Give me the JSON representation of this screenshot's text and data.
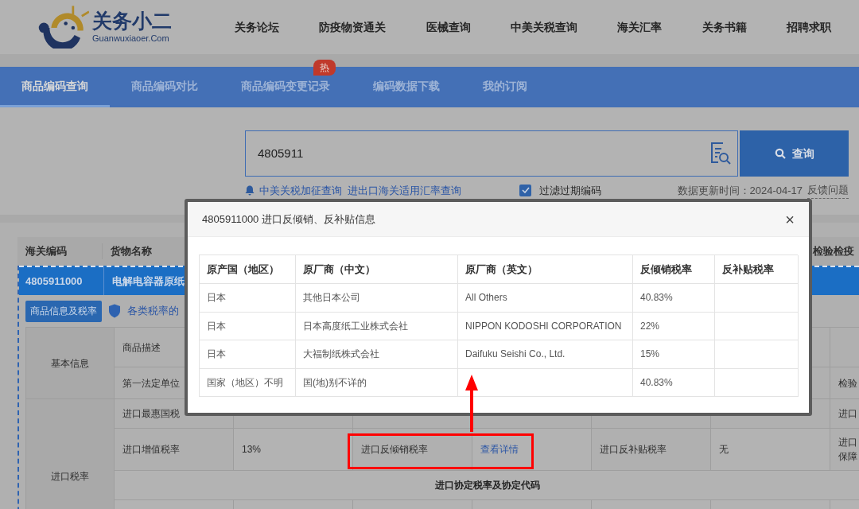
{
  "logo": {
    "name": "关务小二",
    "domain": "Guanwuxiaoer.Com"
  },
  "nav": [
    "关务论坛",
    "防疫物资通关",
    "医械查询",
    "中美关税查询",
    "海关汇率",
    "关务书籍",
    "招聘求职"
  ],
  "tabs": [
    {
      "label": "商品编码查询",
      "selected": true
    },
    {
      "label": "商品编码对比",
      "selected": false
    },
    {
      "label": "商品编码变更记录",
      "selected": false,
      "badge": "热"
    },
    {
      "label": "编码数据下载",
      "selected": false
    },
    {
      "label": "我的订阅",
      "selected": false
    }
  ],
  "search": {
    "value": "4805911",
    "button": "查询"
  },
  "quick_links": [
    "中美关税加征查询",
    "进出口海关适用汇率查询"
  ],
  "filter": {
    "label": "过滤过期编码",
    "checked": true
  },
  "update_time": "数据更新时间：2024-04-17",
  "feedback": "反馈问题",
  "results": {
    "columns": [
      "海关编码",
      "货物名称",
      "检验检疫"
    ],
    "rows": [
      {
        "code": "4805911000",
        "name": "电解电容器原纸",
        "selected": true
      }
    ]
  },
  "detail": {
    "info_button": "商品信息及税率",
    "tax_diff_link": "各类税率的",
    "groups": [
      {
        "label": "基本信息",
        "rows": [
          [
            {
              "text": "商品描述",
              "kind": "label"
            }
          ],
          [
            {
              "text": "第一法定单位",
              "kind": "label"
            },
            null,
            null,
            null,
            null,
            null,
            {
              "text": "检验",
              "kind": "label"
            }
          ]
        ]
      },
      {
        "label": "进口税率",
        "rows": [
          [
            {
              "text": "进口最惠国税",
              "kind": "label"
            },
            null,
            null,
            null,
            null,
            null,
            {
              "text": "进口",
              "kind": "label"
            }
          ],
          [
            {
              "text": "进口增值税率",
              "kind": "label"
            },
            {
              "text": "13%",
              "kind": "value"
            },
            {
              "text": "进口反倾销税率",
              "kind": "label"
            },
            {
              "text": "查看详情",
              "kind": "link"
            },
            {
              "text": "进口反补贴税率",
              "kind": "label"
            },
            {
              "text": "无",
              "kind": "value"
            },
            {
              "text": "进口保障",
              "kind": "label"
            }
          ],
          [
            null,
            null,
            null,
            {
              "text": "进口协定税率及协定代码",
              "kind": "heading"
            }
          ],
          []
        ]
      }
    ]
  },
  "dialog": {
    "title": "4805911000 进口反倾销、反补贴信息",
    "close": "×",
    "columns": [
      "原产国（地区）",
      "原厂商（中文）",
      "原厂商（英文）",
      "反倾销税率",
      "反补贴税率"
    ],
    "rows": [
      {
        "origin": "日本",
        "maker_cn": "其他日本公司",
        "maker_en": "All Others",
        "antidumping_rate": "40.83%"
      },
      {
        "origin": "日本",
        "maker_cn": "日本高度纸工业株式会社",
        "maker_en": "NIPPON KODOSHI CORPORATION",
        "antidumping_rate": "22%"
      },
      {
        "origin": "日本",
        "maker_cn": "大福制纸株式会社",
        "maker_en": "Daifuku Seishi Co., Ltd.",
        "antidumping_rate": "15%"
      },
      {
        "origin": "国家（地区）不明",
        "maker_cn": "国(地)别不详的",
        "antidumping_rate": "40.83%"
      }
    ]
  }
}
